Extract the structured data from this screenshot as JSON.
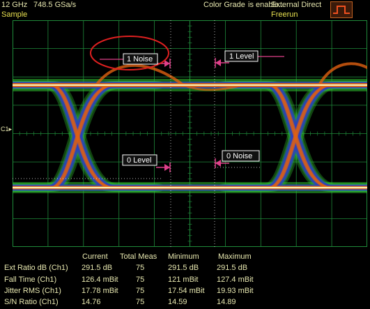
{
  "header": {
    "bandwidth": "12 GHz",
    "sample_rate": "748.5 GSa/s",
    "acq_mode": "Sample",
    "display_mode": "Color Grade",
    "display_status": "is enable...",
    "trigger_source": "External Direct",
    "trigger_mode": "Freerun"
  },
  "channel_marker": "C1",
  "markers": {
    "one_noise": "1 Noise",
    "one_level": "1 Level",
    "zero_level": "0 Level",
    "zero_noise": "0 Noise"
  },
  "measurements": {
    "columns": [
      "Current",
      "Total Meas",
      "Minimum",
      "Maximum"
    ],
    "rows": [
      {
        "name": "Ext Ratio dB (Ch1)",
        "current": "291.5 dB",
        "total": "75",
        "min": "291.5 dB",
        "max": "291.5 dB"
      },
      {
        "name": "Fall Time (Ch1)",
        "current": "126.4 mBit",
        "total": "75",
        "min": "121 mBit",
        "max": "127.4 mBit"
      },
      {
        "name": "Jitter RMS (Ch1)",
        "current": "17.78 mBit",
        "total": "75",
        "min": "17.54 mBit",
        "max": "19.93 mBit"
      },
      {
        "name": "S/N Ratio (Ch1)",
        "current": "14.76",
        "total": "75",
        "min": "14.59",
        "max": "14.89"
      }
    ]
  },
  "colors": {
    "grid": "#1f8a3a",
    "marker": "#e0408a",
    "highlight_circle": "#e02020",
    "trace_hot": "#fff4b0",
    "trace_mid": "#e06010",
    "trace_cool": "#2a40c0",
    "trace_edge": "#30c030"
  }
}
